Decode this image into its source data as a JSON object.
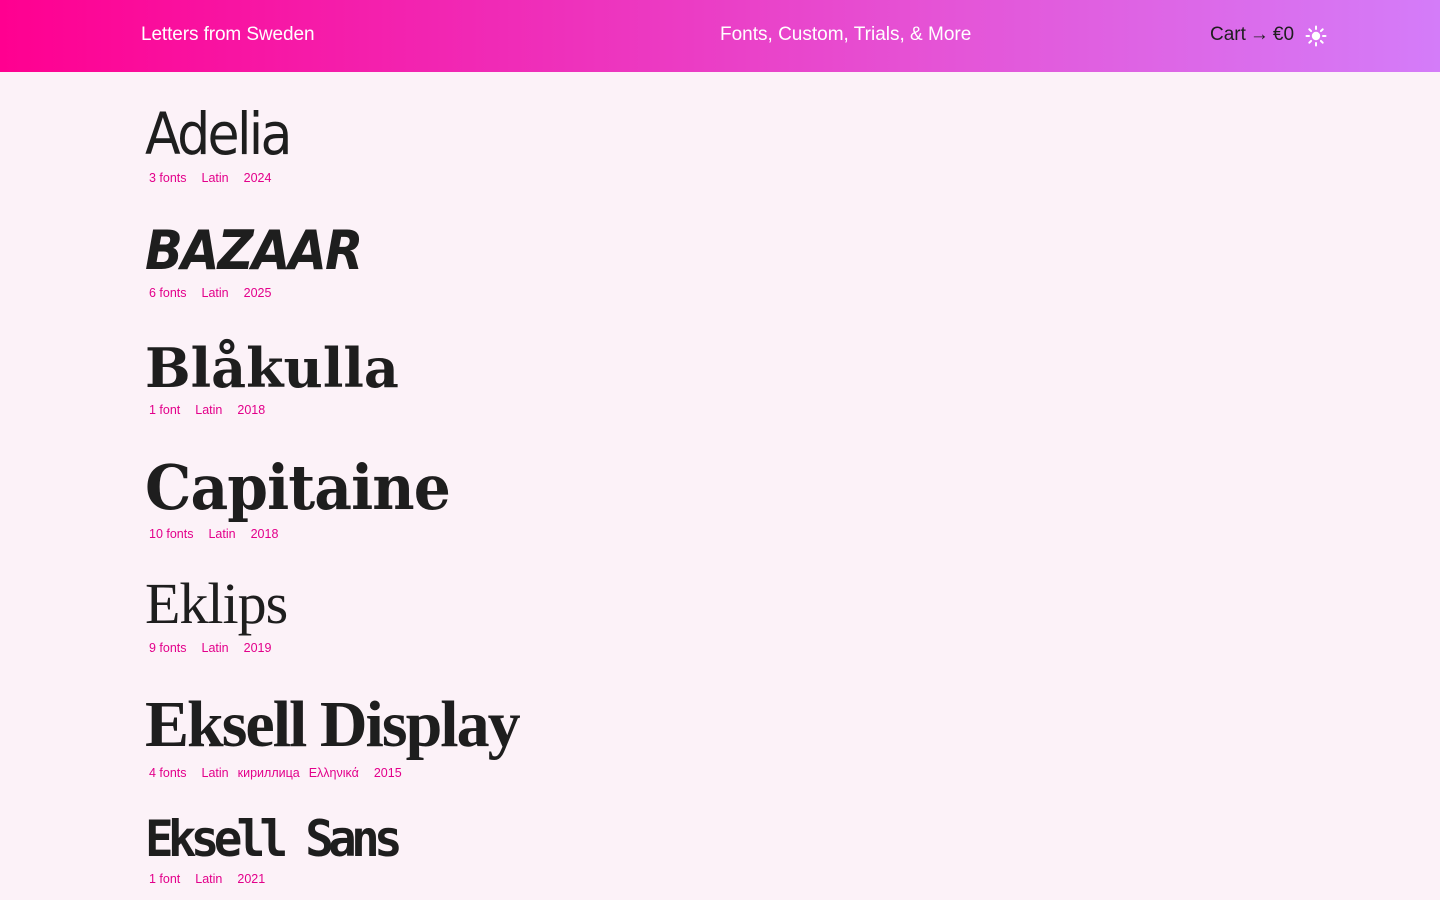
{
  "header": {
    "brand": "Letters from Sweden",
    "nav": "Fonts, Custom, Trials, & More",
    "cart_label": "Cart",
    "cart_arrow": "→",
    "cart_total": "€0",
    "theme_icon": "sun-icon"
  },
  "colors": {
    "accent": "#e3008b",
    "text": "#1e1e1e",
    "background": "#fcf2f8",
    "gradient_start": "#ff0090",
    "gradient_end": "#d47cf9"
  },
  "fonts": [
    {
      "name": "Adelia",
      "count": "3 fonts",
      "scripts": [
        "Latin"
      ],
      "year": "2024"
    },
    {
      "name": "BAZAAR",
      "count": "6 fonts",
      "scripts": [
        "Latin"
      ],
      "year": "2025"
    },
    {
      "name": "Blåkulla",
      "count": "1 font",
      "scripts": [
        "Latin"
      ],
      "year": "2018"
    },
    {
      "name": "Capitaine",
      "count": "10 fonts",
      "scripts": [
        "Latin"
      ],
      "year": "2018"
    },
    {
      "name": "Eklips",
      "count": "9 fonts",
      "scripts": [
        "Latin"
      ],
      "year": "2019"
    },
    {
      "name": "Eksell Display",
      "count": "4 fonts",
      "scripts": [
        "Latin",
        "кириллица",
        "Ελληνικά"
      ],
      "year": "2015"
    },
    {
      "name": "Eksell Sans",
      "count": "1 font",
      "scripts": [
        "Latin"
      ],
      "year": "2021"
    }
  ]
}
